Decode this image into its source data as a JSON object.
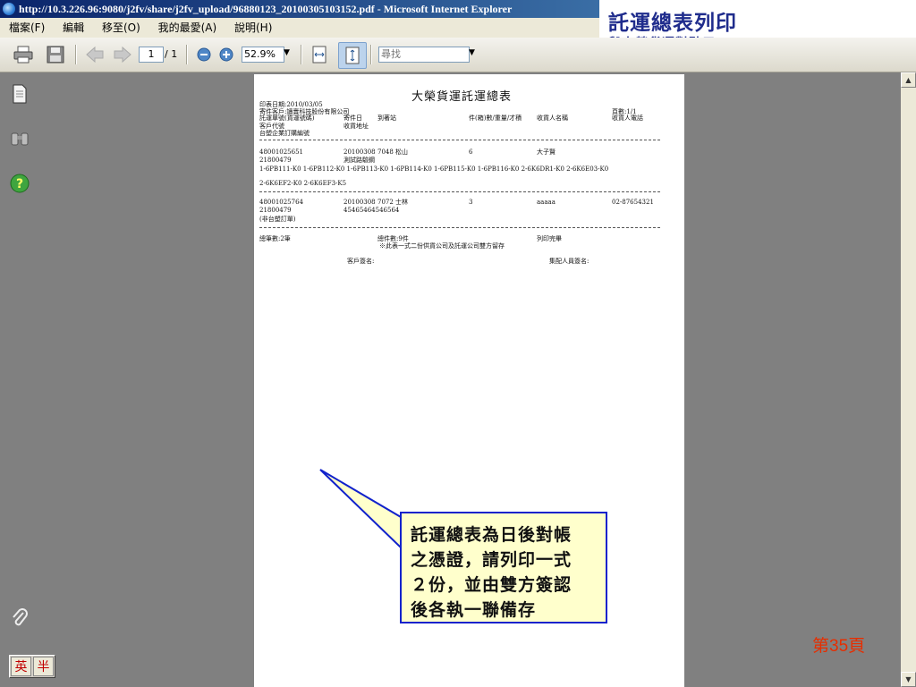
{
  "window": {
    "title": "http://10.3.226.96:9080/j2fv/share/j2fv_upload/96880123_20100305103152.pdf - Microsoft Internet Explorer"
  },
  "heading": {
    "title": "託運總表列印",
    "subtitle": "與大榮貨運對點用"
  },
  "menu": [
    "檔案(F)",
    "編輯",
    "移至(O)",
    "我的最愛(A)",
    "說明(H)"
  ],
  "toolbar": {
    "page_current": "1",
    "page_total": "/ 1",
    "zoom": "52.9%",
    "find_placeholder": "尋找"
  },
  "document": {
    "title": "大榮貨運託運總表",
    "print_date": "印表日期:2010/03/05",
    "page_count": "頁數:1/1",
    "header": {
      "row1_left": "寄件客戶:讀賣科技股份有限公司",
      "row2_a": "託運單號(貨運號碼)",
      "row2_b": "寄件日",
      "row2_c": "到著站",
      "row2_d": "件(箱)數/重量/才積",
      "row2_e": "收貨人名稱",
      "row2_f": "收貨人電話",
      "row3_a": "客戶代號",
      "row3_b": "收貨地址",
      "row4_a": "台塑企業訂購編號"
    },
    "rows": [
      {
        "no": "48001025651",
        "date": "20100308",
        "station": "7048  松山",
        "count": "6",
        "receiver": "大子賢",
        "phone": "",
        "code": "21800479",
        "address": "測試路驗鋼",
        "items1": "1-6PB111-K0 1-6PB112-K0 1-6PB113-K0 1-6PB114-K0 1-6PB115-K0 1-6PB116-K0 2-6K6DR1-K0 2-6K6E03-K0",
        "items2": "2-6K6EF2-K0 2-6K6EF3-K5"
      },
      {
        "no": "48001025764",
        "date": "20100308",
        "station": "7072  士林",
        "count": "3",
        "receiver": "aaaaa",
        "phone": "02-87654321",
        "code": "21800479",
        "address": "45465464546564",
        "note": "(非台塑訂單)"
      }
    ],
    "summary": {
      "total_records": "總筆數:2筆",
      "total_pieces": "總件數:9件",
      "printed": "列印完畢",
      "copies_note": "※此表一式二份供貨公司及託運公司雙方留存",
      "customer_sign": "客戶簽名:",
      "driver_sign": "集配人員簽名:"
    }
  },
  "callout": {
    "lines": [
      "託運總表為日後對帳",
      "之憑證，請列印一式",
      "２份，並由雙方簽認",
      "後各執一聯備存"
    ]
  },
  "ime": {
    "eng": "英",
    "half": "半"
  },
  "slide_number": "第35頁"
}
